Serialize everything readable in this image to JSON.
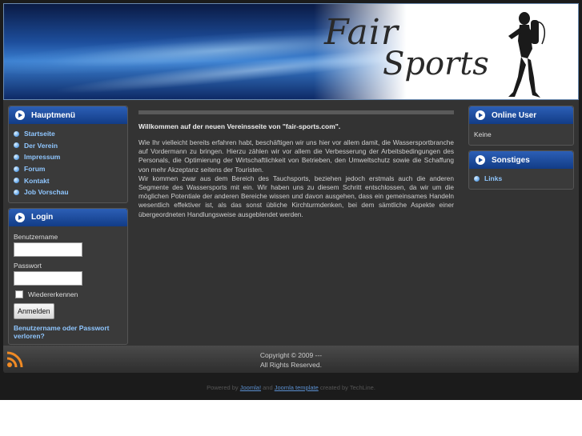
{
  "header": {
    "logo_line1": "Fair",
    "logo_line2": "Sports"
  },
  "main_menu": {
    "title": "Hauptmenü",
    "items": [
      {
        "label": "Startseite"
      },
      {
        "label": "Der Verein"
      },
      {
        "label": "Impressum"
      },
      {
        "label": "Forum"
      },
      {
        "label": "Kontakt"
      },
      {
        "label": "Job Vorschau"
      }
    ]
  },
  "login": {
    "title": "Login",
    "username_label": "Benutzername",
    "password_label": "Passwort",
    "username_value": "",
    "password_value": "",
    "remember_label": "Wiedererkennen",
    "button_label": "Anmelden",
    "forgot_link": "Benutzername oder Passwort verloren?"
  },
  "online_user": {
    "title": "Online User",
    "text": "Keine"
  },
  "sonstiges": {
    "title": "Sonstiges",
    "items": [
      {
        "label": "Links"
      }
    ]
  },
  "main": {
    "heading": "Willkommen auf der neuen Vereinsseite von \"fair-sports.com\".",
    "paragraph1": "Wie Ihr vielleicht bereits erfahren habt, beschäftigen wir uns hier vor allem damit, die Wassersportbranche auf Vordermann zu bringen. Hierzu zählen wir vor allem die Verbesserung der Arbeitsbedingungen des Personals, die Optimierung der Wirtschaftlichkeit von Betrieben, den Umweltschutz sowie die Schaffung von mehr Akzeptanz seitens der Touristen.",
    "paragraph2": "Wir kommen zwar aus dem Bereich des Tauchsports, beziehen jedoch erstmals auch die anderen Segmente des Wassersports mit ein. Wir haben uns zu diesem Schritt entschlossen, da wir um die möglichen Potentiale der anderen Bereiche wissen und davon ausgehen, dass ein gemeinsames Handeln wesentlich effektiver ist, als das sonst übliche Kirchturmdenken, bei dem sämtliche Aspekte einer übergeordneten Handlungsweise ausgeblendet werden."
  },
  "footer": {
    "copyright": "Copyright © 2009 ---",
    "rights": "All Rights Reserved.",
    "powered_prefix": "Powered by",
    "joomla_link": "Joomla!",
    "and_text": "and",
    "template_link": "Joomla template",
    "created_by": "created by TechLine."
  },
  "colors": {
    "accent_blue": "#1a4a9a",
    "link_blue": "#8fc6ff",
    "rss_orange": "#f08a24"
  }
}
